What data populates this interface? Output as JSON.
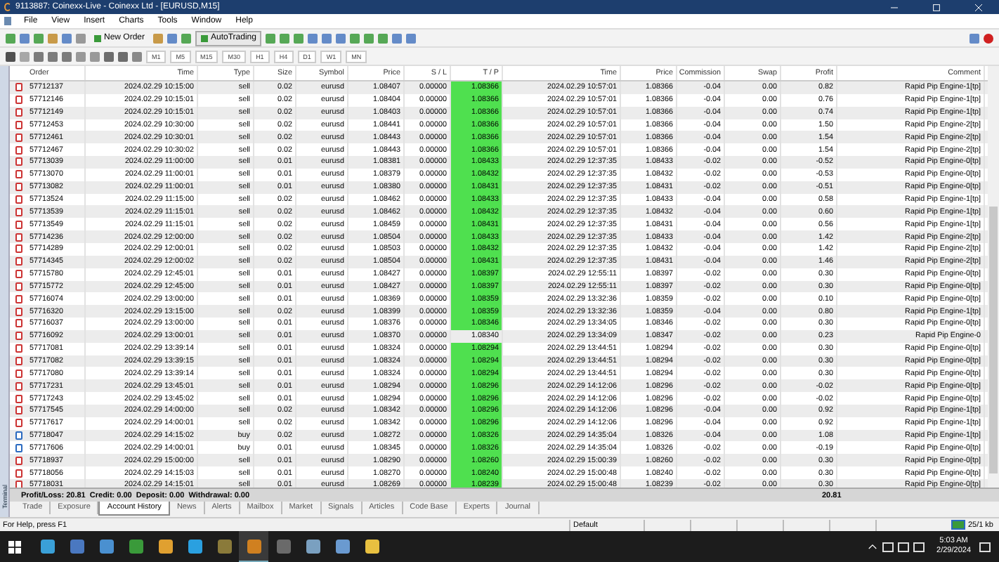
{
  "window": {
    "title": "9113887: Coinexx-Live - Coinexx Ltd - [EURUSD,M15]"
  },
  "menu": [
    "File",
    "View",
    "Insert",
    "Charts",
    "Tools",
    "Window",
    "Help"
  ],
  "toolbar": {
    "new_order": "New Order",
    "autotrading": "AutoTrading",
    "timeframes": [
      "M1",
      "M5",
      "M15",
      "M30",
      "H1",
      "H4",
      "D1",
      "W1",
      "MN"
    ]
  },
  "table": {
    "columns": [
      "Order",
      "Time",
      "Type",
      "Size",
      "Symbol",
      "Price",
      "S / L",
      "T / P",
      "Time",
      "Price",
      "Commission",
      "Swap",
      "Profit",
      "Comment"
    ],
    "rows": [
      {
        "kind": "sell",
        "tp_highlight": true,
        "cells": [
          "57712137",
          "2024.02.29 10:15:00",
          "sell",
          "0.02",
          "eurusd",
          "1.08407",
          "0.00000",
          "1.08366",
          "2024.02.29 10:57:01",
          "1.08366",
          "-0.04",
          "0.00",
          "0.82",
          "Rapid Pip Engine-1[tp]"
        ]
      },
      {
        "kind": "sell",
        "tp_highlight": true,
        "cells": [
          "57712146",
          "2024.02.29 10:15:01",
          "sell",
          "0.02",
          "eurusd",
          "1.08404",
          "0.00000",
          "1.08366",
          "2024.02.29 10:57:01",
          "1.08366",
          "-0.04",
          "0.00",
          "0.76",
          "Rapid Pip Engine-1[tp]"
        ]
      },
      {
        "kind": "sell",
        "tp_highlight": true,
        "cells": [
          "57712149",
          "2024.02.29 10:15:01",
          "sell",
          "0.02",
          "eurusd",
          "1.08403",
          "0.00000",
          "1.08366",
          "2024.02.29 10:57:01",
          "1.08366",
          "-0.04",
          "0.00",
          "0.74",
          "Rapid Pip Engine-1[tp]"
        ]
      },
      {
        "kind": "sell",
        "tp_highlight": true,
        "cells": [
          "57712453",
          "2024.02.29 10:30:00",
          "sell",
          "0.02",
          "eurusd",
          "1.08441",
          "0.00000",
          "1.08366",
          "2024.02.29 10:57:01",
          "1.08366",
          "-0.04",
          "0.00",
          "1.50",
          "Rapid Pip Engine-2[tp]"
        ]
      },
      {
        "kind": "sell",
        "tp_highlight": true,
        "cells": [
          "57712461",
          "2024.02.29 10:30:01",
          "sell",
          "0.02",
          "eurusd",
          "1.08443",
          "0.00000",
          "1.08366",
          "2024.02.29 10:57:01",
          "1.08366",
          "-0.04",
          "0.00",
          "1.54",
          "Rapid Pip Engine-2[tp]"
        ]
      },
      {
        "kind": "sell",
        "tp_highlight": true,
        "cells": [
          "57712467",
          "2024.02.29 10:30:02",
          "sell",
          "0.02",
          "eurusd",
          "1.08443",
          "0.00000",
          "1.08366",
          "2024.02.29 10:57:01",
          "1.08366",
          "-0.04",
          "0.00",
          "1.54",
          "Rapid Pip Engine-2[tp]"
        ]
      },
      {
        "kind": "sell",
        "tp_highlight": true,
        "cells": [
          "57713039",
          "2024.02.29 11:00:00",
          "sell",
          "0.01",
          "eurusd",
          "1.08381",
          "0.00000",
          "1.08433",
          "2024.02.29 12:37:35",
          "1.08433",
          "-0.02",
          "0.00",
          "-0.52",
          "Rapid Pip Engine-0[tp]"
        ]
      },
      {
        "kind": "sell",
        "tp_highlight": true,
        "cells": [
          "57713070",
          "2024.02.29 11:00:01",
          "sell",
          "0.01",
          "eurusd",
          "1.08379",
          "0.00000",
          "1.08432",
          "2024.02.29 12:37:35",
          "1.08432",
          "-0.02",
          "0.00",
          "-0.53",
          "Rapid Pip Engine-0[tp]"
        ]
      },
      {
        "kind": "sell",
        "tp_highlight": true,
        "cells": [
          "57713082",
          "2024.02.29 11:00:01",
          "sell",
          "0.01",
          "eurusd",
          "1.08380",
          "0.00000",
          "1.08431",
          "2024.02.29 12:37:35",
          "1.08431",
          "-0.02",
          "0.00",
          "-0.51",
          "Rapid Pip Engine-0[tp]"
        ]
      },
      {
        "kind": "sell",
        "tp_highlight": true,
        "cells": [
          "57713524",
          "2024.02.29 11:15:00",
          "sell",
          "0.02",
          "eurusd",
          "1.08462",
          "0.00000",
          "1.08433",
          "2024.02.29 12:37:35",
          "1.08433",
          "-0.04",
          "0.00",
          "0.58",
          "Rapid Pip Engine-1[tp]"
        ]
      },
      {
        "kind": "sell",
        "tp_highlight": true,
        "cells": [
          "57713539",
          "2024.02.29 11:15:01",
          "sell",
          "0.02",
          "eurusd",
          "1.08462",
          "0.00000",
          "1.08432",
          "2024.02.29 12:37:35",
          "1.08432",
          "-0.04",
          "0.00",
          "0.60",
          "Rapid Pip Engine-1[tp]"
        ]
      },
      {
        "kind": "sell",
        "tp_highlight": true,
        "cells": [
          "57713549",
          "2024.02.29 11:15:01",
          "sell",
          "0.02",
          "eurusd",
          "1.08459",
          "0.00000",
          "1.08431",
          "2024.02.29 12:37:35",
          "1.08431",
          "-0.04",
          "0.00",
          "0.56",
          "Rapid Pip Engine-1[tp]"
        ]
      },
      {
        "kind": "sell",
        "tp_highlight": true,
        "cells": [
          "57714236",
          "2024.02.29 12:00:00",
          "sell",
          "0.02",
          "eurusd",
          "1.08504",
          "0.00000",
          "1.08433",
          "2024.02.29 12:37:35",
          "1.08433",
          "-0.04",
          "0.00",
          "1.42",
          "Rapid Pip Engine-2[tp]"
        ]
      },
      {
        "kind": "sell",
        "tp_highlight": true,
        "cells": [
          "57714289",
          "2024.02.29 12:00:01",
          "sell",
          "0.02",
          "eurusd",
          "1.08503",
          "0.00000",
          "1.08432",
          "2024.02.29 12:37:35",
          "1.08432",
          "-0.04",
          "0.00",
          "1.42",
          "Rapid Pip Engine-2[tp]"
        ]
      },
      {
        "kind": "sell",
        "tp_highlight": true,
        "cells": [
          "57714345",
          "2024.02.29 12:00:02",
          "sell",
          "0.02",
          "eurusd",
          "1.08504",
          "0.00000",
          "1.08431",
          "2024.02.29 12:37:35",
          "1.08431",
          "-0.04",
          "0.00",
          "1.46",
          "Rapid Pip Engine-2[tp]"
        ]
      },
      {
        "kind": "sell",
        "tp_highlight": true,
        "cells": [
          "57715780",
          "2024.02.29 12:45:01",
          "sell",
          "0.01",
          "eurusd",
          "1.08427",
          "0.00000",
          "1.08397",
          "2024.02.29 12:55:11",
          "1.08397",
          "-0.02",
          "0.00",
          "0.30",
          "Rapid Pip Engine-0[tp]"
        ]
      },
      {
        "kind": "sell",
        "tp_highlight": true,
        "cells": [
          "57715772",
          "2024.02.29 12:45:00",
          "sell",
          "0.01",
          "eurusd",
          "1.08427",
          "0.00000",
          "1.08397",
          "2024.02.29 12:55:11",
          "1.08397",
          "-0.02",
          "0.00",
          "0.30",
          "Rapid Pip Engine-0[tp]"
        ]
      },
      {
        "kind": "sell",
        "tp_highlight": true,
        "cells": [
          "57716074",
          "2024.02.29 13:00:00",
          "sell",
          "0.01",
          "eurusd",
          "1.08369",
          "0.00000",
          "1.08359",
          "2024.02.29 13:32:36",
          "1.08359",
          "-0.02",
          "0.00",
          "0.10",
          "Rapid Pip Engine-0[tp]"
        ]
      },
      {
        "kind": "sell",
        "tp_highlight": true,
        "cells": [
          "57716320",
          "2024.02.29 13:15:00",
          "sell",
          "0.02",
          "eurusd",
          "1.08399",
          "0.00000",
          "1.08359",
          "2024.02.29 13:32:36",
          "1.08359",
          "-0.04",
          "0.00",
          "0.80",
          "Rapid Pip Engine-1[tp]"
        ]
      },
      {
        "kind": "sell",
        "tp_highlight": true,
        "cells": [
          "57716037",
          "2024.02.29 13:00:00",
          "sell",
          "0.01",
          "eurusd",
          "1.08376",
          "0.00000",
          "1.08346",
          "2024.02.29 13:34:05",
          "1.08346",
          "-0.02",
          "0.00",
          "0.30",
          "Rapid Pip Engine-0[tp]"
        ]
      },
      {
        "kind": "sell",
        "tp_highlight": false,
        "cells": [
          "57716092",
          "2024.02.29 13:00:01",
          "sell",
          "0.01",
          "eurusd",
          "1.08370",
          "0.00000",
          "1.08340",
          "2024.02.29 13:34:09",
          "1.08347",
          "-0.02",
          "0.00",
          "0.23",
          "Rapid Pip Engine-0"
        ]
      },
      {
        "kind": "sell",
        "tp_highlight": true,
        "cells": [
          "57717081",
          "2024.02.29 13:39:14",
          "sell",
          "0.01",
          "eurusd",
          "1.08324",
          "0.00000",
          "1.08294",
          "2024.02.29 13:44:51",
          "1.08294",
          "-0.02",
          "0.00",
          "0.30",
          "Rapid Pip Engine-0[tp]"
        ]
      },
      {
        "kind": "sell",
        "tp_highlight": true,
        "cells": [
          "57717082",
          "2024.02.29 13:39:15",
          "sell",
          "0.01",
          "eurusd",
          "1.08324",
          "0.00000",
          "1.08294",
          "2024.02.29 13:44:51",
          "1.08294",
          "-0.02",
          "0.00",
          "0.30",
          "Rapid Pip Engine-0[tp]"
        ]
      },
      {
        "kind": "sell",
        "tp_highlight": true,
        "cells": [
          "57717080",
          "2024.02.29 13:39:14",
          "sell",
          "0.01",
          "eurusd",
          "1.08324",
          "0.00000",
          "1.08294",
          "2024.02.29 13:44:51",
          "1.08294",
          "-0.02",
          "0.00",
          "0.30",
          "Rapid Pip Engine-0[tp]"
        ]
      },
      {
        "kind": "sell",
        "tp_highlight": true,
        "cells": [
          "57717231",
          "2024.02.29 13:45:01",
          "sell",
          "0.01",
          "eurusd",
          "1.08294",
          "0.00000",
          "1.08296",
          "2024.02.29 14:12:06",
          "1.08296",
          "-0.02",
          "0.00",
          "-0.02",
          "Rapid Pip Engine-0[tp]"
        ]
      },
      {
        "kind": "sell",
        "tp_highlight": true,
        "cells": [
          "57717243",
          "2024.02.29 13:45:02",
          "sell",
          "0.01",
          "eurusd",
          "1.08294",
          "0.00000",
          "1.08296",
          "2024.02.29 14:12:06",
          "1.08296",
          "-0.02",
          "0.00",
          "-0.02",
          "Rapid Pip Engine-0[tp]"
        ]
      },
      {
        "kind": "sell",
        "tp_highlight": true,
        "cells": [
          "57717545",
          "2024.02.29 14:00:00",
          "sell",
          "0.02",
          "eurusd",
          "1.08342",
          "0.00000",
          "1.08296",
          "2024.02.29 14:12:06",
          "1.08296",
          "-0.04",
          "0.00",
          "0.92",
          "Rapid Pip Engine-1[tp]"
        ]
      },
      {
        "kind": "sell",
        "tp_highlight": true,
        "cells": [
          "57717617",
          "2024.02.29 14:00:01",
          "sell",
          "0.02",
          "eurusd",
          "1.08342",
          "0.00000",
          "1.08296",
          "2024.02.29 14:12:06",
          "1.08296",
          "-0.04",
          "0.00",
          "0.92",
          "Rapid Pip Engine-1[tp]"
        ]
      },
      {
        "kind": "buy",
        "tp_highlight": true,
        "cells": [
          "57718047",
          "2024.02.29 14:15:02",
          "buy",
          "0.02",
          "eurusd",
          "1.08272",
          "0.00000",
          "1.08326",
          "2024.02.29 14:35:04",
          "1.08326",
          "-0.04",
          "0.00",
          "1.08",
          "Rapid Pip Engine-1[tp]"
        ]
      },
      {
        "kind": "buy",
        "tp_highlight": true,
        "cells": [
          "57717606",
          "2024.02.29 14:00:01",
          "buy",
          "0.01",
          "eurusd",
          "1.08345",
          "0.00000",
          "1.08326",
          "2024.02.29 14:35:04",
          "1.08326",
          "-0.02",
          "0.00",
          "-0.19",
          "Rapid Pip Engine-0[tp]"
        ]
      },
      {
        "kind": "sell",
        "tp_highlight": true,
        "cells": [
          "57718937",
          "2024.02.29 15:00:00",
          "sell",
          "0.01",
          "eurusd",
          "1.08290",
          "0.00000",
          "1.08260",
          "2024.02.29 15:00:39",
          "1.08260",
          "-0.02",
          "0.00",
          "0.30",
          "Rapid Pip Engine-0[tp]"
        ]
      },
      {
        "kind": "sell",
        "tp_highlight": true,
        "cells": [
          "57718056",
          "2024.02.29 14:15:03",
          "sell",
          "0.01",
          "eurusd",
          "1.08270",
          "0.00000",
          "1.08240",
          "2024.02.29 15:00:48",
          "1.08240",
          "-0.02",
          "0.00",
          "0.30",
          "Rapid Pip Engine-0[tp]"
        ]
      },
      {
        "kind": "sell",
        "tp_highlight": true,
        "cells": [
          "57718031",
          "2024.02.29 14:15:01",
          "sell",
          "0.01",
          "eurusd",
          "1.08269",
          "0.00000",
          "1.08239",
          "2024.02.29 15:00:48",
          "1.08239",
          "-0.02",
          "0.00",
          "0.30",
          "Rapid Pip Engine-0[tp]"
        ]
      }
    ],
    "summary": {
      "text": "Profit/Loss: 20.81  Credit: 0.00  Deposit: 0.00  Withdrawal: 0.00",
      "total": "20.81"
    }
  },
  "side_label": "Terminal",
  "tabs": [
    {
      "label": "Trade",
      "selected": false
    },
    {
      "label": "Exposure",
      "selected": false
    },
    {
      "label": "Account History",
      "selected": true
    },
    {
      "label": "News",
      "selected": false
    },
    {
      "label": "Alerts",
      "selected": false
    },
    {
      "label": "Mailbox",
      "selected": false
    },
    {
      "label": "Market",
      "selected": false
    },
    {
      "label": "Signals",
      "selected": false
    },
    {
      "label": "Articles",
      "selected": false
    },
    {
      "label": "Code Base",
      "selected": false
    },
    {
      "label": "Experts",
      "selected": false
    },
    {
      "label": "Journal",
      "selected": false
    }
  ],
  "status_bar": {
    "help": "For Help, press F1",
    "profile": "Default",
    "traffic": "25/1 kb"
  },
  "taskbar": {
    "time": "5:03 AM",
    "date": "2/29/2024"
  }
}
